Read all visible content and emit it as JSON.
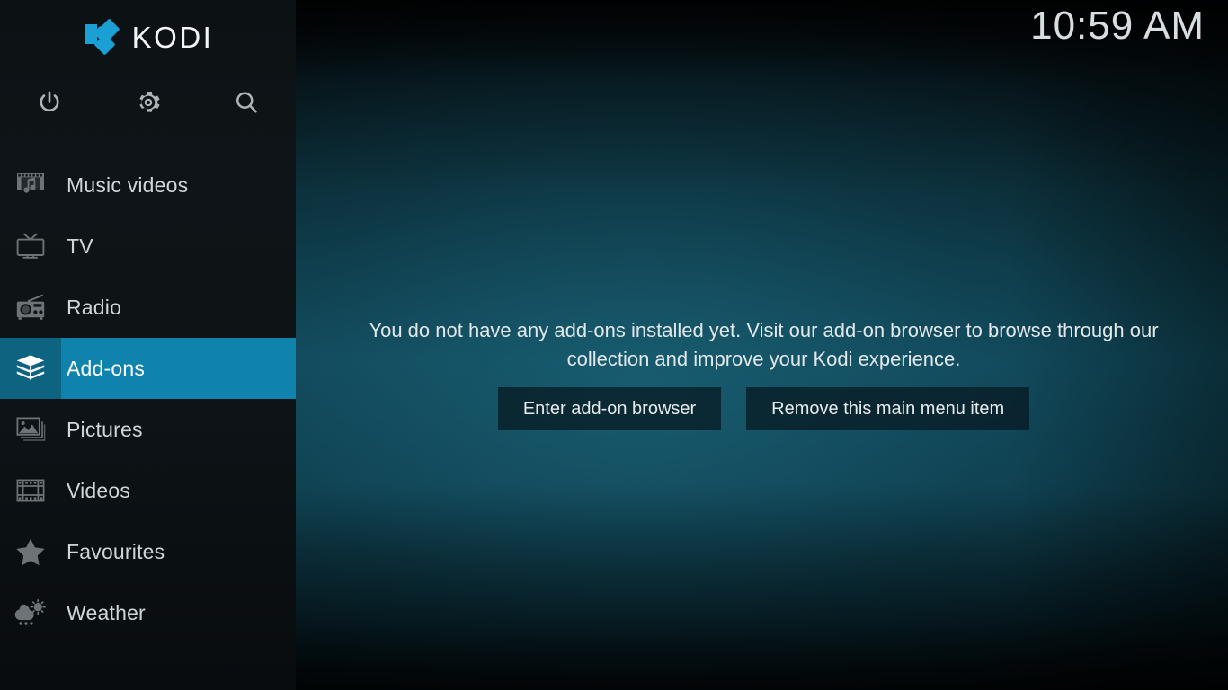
{
  "app": {
    "name": "Kodi",
    "logo_text": "KODI",
    "logo_icon": "kodi-logo-icon"
  },
  "header": {
    "clock": "10:59 AM"
  },
  "sidebar": {
    "toolbar": [
      {
        "name": "power",
        "icon": "power-icon",
        "label": "Power"
      },
      {
        "name": "settings",
        "icon": "gear-icon",
        "label": "Settings"
      },
      {
        "name": "search",
        "icon": "search-icon",
        "label": "Search"
      }
    ],
    "items": [
      {
        "label": "Music videos",
        "icon": "music-video-icon",
        "selected": false
      },
      {
        "label": "TV",
        "icon": "tv-icon",
        "selected": false
      },
      {
        "label": "Radio",
        "icon": "radio-icon",
        "selected": false
      },
      {
        "label": "Add-ons",
        "icon": "addons-box-icon",
        "selected": true
      },
      {
        "label": "Pictures",
        "icon": "pictures-icon",
        "selected": false
      },
      {
        "label": "Videos",
        "icon": "film-strip-icon",
        "selected": false
      },
      {
        "label": "Favourites",
        "icon": "star-icon",
        "selected": false
      },
      {
        "label": "Weather",
        "icon": "weather-cloud-sun-rain-icon",
        "selected": false
      }
    ]
  },
  "main": {
    "message": "You do not have any add-ons installed yet. Visit our add-on browser to browse through our collection and improve your Kodi experience.",
    "buttons": [
      {
        "label": "Enter add-on browser",
        "name": "enter-addon-browser-button"
      },
      {
        "label": "Remove this main menu item",
        "name": "remove-main-menu-item-button"
      }
    ]
  },
  "colors": {
    "accent": "#1ba0d6",
    "selected_label_bg": "#1083ad",
    "selected_icon_bg": "#0e6380",
    "sidebar_bg": "#0d1316",
    "text": "#cfd6d9"
  }
}
